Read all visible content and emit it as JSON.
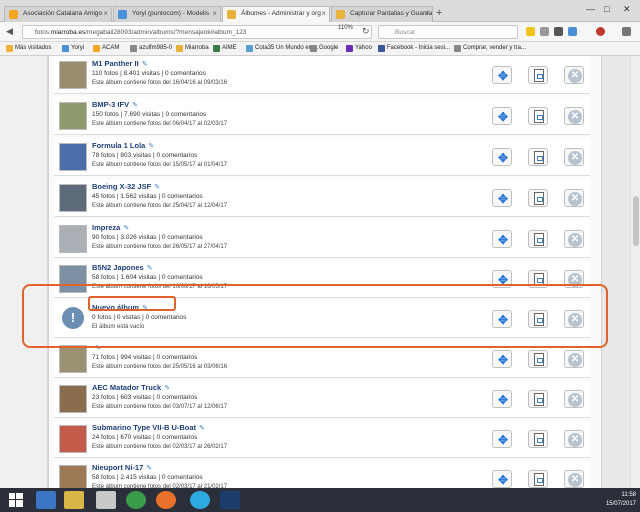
{
  "tabs": [
    {
      "label": "Asociación Catalana Amigo",
      "color": "#f5a623"
    },
    {
      "label": "Yoryi (puntocom) - Modelis",
      "color": "#4a90d9"
    },
    {
      "label": "Álbumes - Administrar y org",
      "color": "#e9b23a"
    },
    {
      "label": "Capturar Pantallas y Guarda",
      "color": "#e9b23a"
    }
  ],
  "newtab_label": "+",
  "url": {
    "prefix": "fotos.",
    "domain": "miarroba.es",
    "path": "/megabail28093/admin/albums/?mensajeok#album_123"
  },
  "zoom": "110%",
  "search_placeholder": "Buscar",
  "bookmarks": [
    {
      "label": "Más visitados",
      "color": "#f0b43c"
    },
    {
      "label": "Yoryi",
      "color": "#4a90d9"
    },
    {
      "label": "ACAM",
      "color": "#f5a623"
    },
    {
      "label": "azulfm985-0",
      "color": "#888"
    },
    {
      "label": "Miarroba",
      "color": "#e9b23a"
    },
    {
      "label": "AIME",
      "color": "#3a7d44"
    },
    {
      "label": "Cota35 Un Mundo en ...",
      "color": "#5aa0d0"
    },
    {
      "label": "Google",
      "color": "#888"
    },
    {
      "label": "Yahoo",
      "color": "#6b2bb5"
    },
    {
      "label": "Facebook - Inicia sesi...",
      "color": "#3b5998"
    },
    {
      "label": "Comprar, vender y tra...",
      "color": "#888"
    }
  ],
  "albums": [
    {
      "title": "M1 Panther II",
      "stats": "110 fotos | 8.401 visitas | 0 comentarios",
      "dates": "Este álbum contiene fotos del 16/04/16 al 09/03/16",
      "thumb": "#9a8c6e",
      "empty": false
    },
    {
      "title": "BMP-3 IFV",
      "stats": "150 fotos | 7.690 visitas | 0 comentarios",
      "dates": "Este álbum contiene fotos del 06/04/17 al 02/03/17",
      "thumb": "#8f9a6e",
      "empty": false
    },
    {
      "title": "Formula 1 Lola",
      "stats": "78 fotos | 803 visitas | 0 comentarios",
      "dates": "Este álbum contiene fotos del 15/05/17 al 01/04/17",
      "thumb": "#4b6ea8",
      "empty": false
    },
    {
      "title": "Boeing X-32 JSF",
      "stats": "45 fotos | 1.562 visitas | 0 comentarios",
      "dates": "Este álbum contiene fotos del 25/04/17 al 12/04/17",
      "thumb": "#5d6a7a",
      "empty": false
    },
    {
      "title": "Impreza",
      "stats": "90 fotos | 3.026 visitas | 0 comentarios",
      "dates": "Este álbum contiene fotos del 26/05/17 al 27/04/17",
      "thumb": "#aab0b6",
      "empty": false
    },
    {
      "title": "B5N2 Japones",
      "stats": "58 fotos | 1.604 visitas | 0 comentarios",
      "dates": "Este álbum contiene fotos del 16/06/17 al 16/05/17",
      "thumb": "#7d8fa3",
      "empty": false
    },
    {
      "title": "Nuevo álbum",
      "stats": "0 fotos | 0 visitas | 0 comentarios",
      "dates": "El álbum está vacío",
      "thumb": "#6b8fb3",
      "empty": true
    },
    {
      "title": "",
      "stats": "71 fotos | 994 visitas | 0 comentarios",
      "dates": "Este álbum contiene fotos del 25/05/16 al 03/06/16",
      "thumb": "#9b9272",
      "empty": false
    },
    {
      "title": "AEC Matador Truck",
      "stats": "23 fotos | 603 visitas | 0 comentarios",
      "dates": "Este álbum contiene fotos del 03/07/17 al 12/06/17",
      "thumb": "#8a6d4e",
      "empty": false
    },
    {
      "title": "Submarino Type VII-B U-Boat",
      "stats": "24 fotos | 670 visitas | 0 comentarios",
      "dates": "Este álbum contiene fotos del 02/03/17 al 26/02/17",
      "thumb": "#c25a4a",
      "empty": false
    },
    {
      "title": "Nieuport Ni-17",
      "stats": "58 fotos | 2.415 visitas | 0 comentarios",
      "dates": "Este álbum contiene fotos del 02/03/17 al 21/02/17",
      "thumb": "#9c7a55",
      "empty": false
    }
  ],
  "warning_glyph": "!",
  "taskbar": {
    "time": "11:58",
    "date": "15/07/2017"
  },
  "colors": {
    "annotation": "#e0622c",
    "accent": "#2c7ad6"
  }
}
